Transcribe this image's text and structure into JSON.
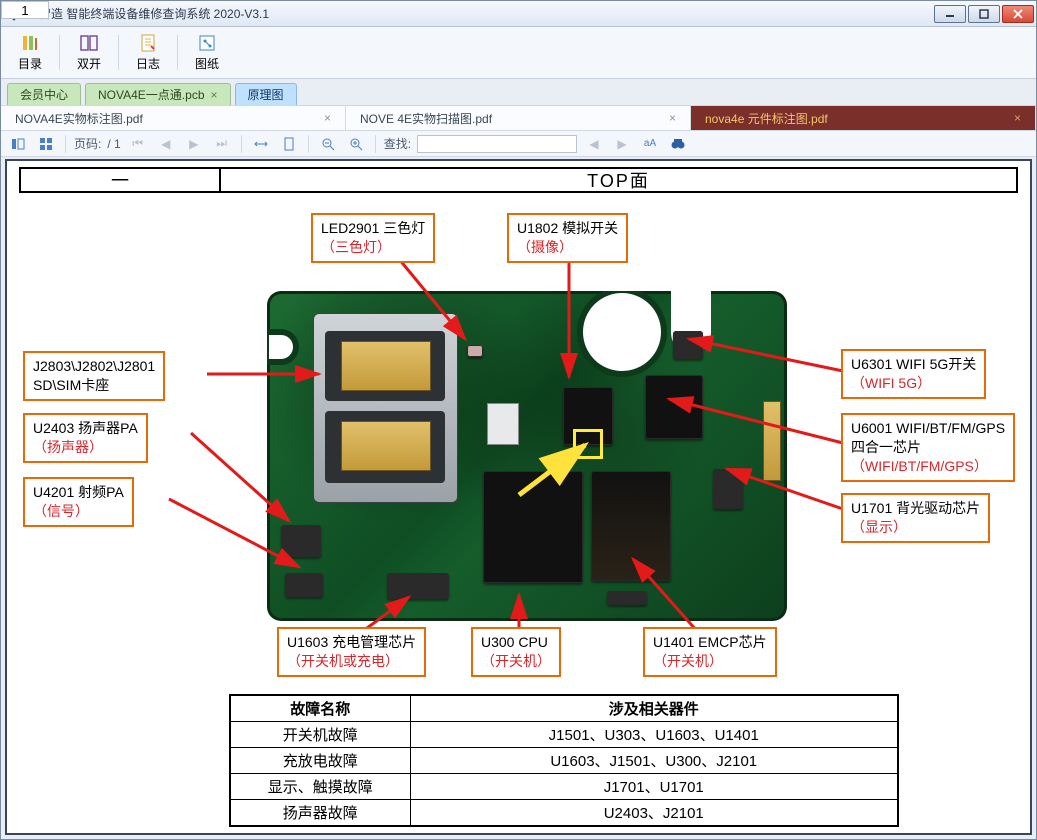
{
  "window": {
    "title": "鑫智造 智能终端设备维修查询系统 2020-V3.1"
  },
  "toolbar": {
    "catalog": "目录",
    "dual": "双开",
    "log": "日志",
    "drawing": "图纸"
  },
  "main_tabs": [
    {
      "label": "会员中心"
    },
    {
      "label": "NOVA4E一点通.pcb"
    },
    {
      "label": "原理图",
      "active": true
    }
  ],
  "sub_tabs": [
    {
      "label": "NOVA4E实物标注图.pdf"
    },
    {
      "label": "NOVE 4E实物扫描图.pdf"
    },
    {
      "label": "nova4e 元件标注图.pdf",
      "active": true
    }
  ],
  "pdf_bar": {
    "page_label": "页码:",
    "page_value": "1",
    "page_total": "/ 1",
    "find_label": "查找:"
  },
  "doc": {
    "head_a": "一",
    "head_b": "TOP面",
    "callouts": {
      "led2901": {
        "t1": "LED2901  三色灯",
        "t2": "（三色灯）"
      },
      "u1802": {
        "t1": "U1802 模拟开关",
        "t2": "（摄像）"
      },
      "j2803": {
        "t1": "J2803\\J2802\\J2801",
        "t2": "SD\\SIM卡座"
      },
      "u2403": {
        "t1": "U2403 扬声器PA",
        "t2": "（扬声器）"
      },
      "u4201": {
        "t1": "U4201  射频PA",
        "t2": "（信号）"
      },
      "u6301": {
        "t1": "U6301 WIFI 5G开关",
        "t2": "（WIFI 5G）"
      },
      "u6001": {
        "t1": "U6001 WIFI/BT/FM/GPS",
        "t2": "四合一芯片",
        "t3": "（WIFI/BT/FM/GPS）"
      },
      "u1701": {
        "t1": "U1701 背光驱动芯片",
        "t2": "（显示）"
      },
      "u1603": {
        "t1": "U1603 充电管理芯片",
        "t2": "（开关机或充电）"
      },
      "u300": {
        "t1": "U300 CPU",
        "t2": "（开关机）"
      },
      "u1401": {
        "t1": "U1401 EMCP芯片",
        "t2": "（开关机）"
      }
    },
    "fault_table": {
      "h1": "故障名称",
      "h2": "涉及相关器件",
      "rows": [
        {
          "a": "开关机故障",
          "b": "J1501、U303、U1603、U1401"
        },
        {
          "a": "充放电故障",
          "b": "U1603、J1501、U300、J2101"
        },
        {
          "a": "显示、触摸故障",
          "b": "J1701、U1701"
        },
        {
          "a": "扬声器故障",
          "b": "U2403、J2101"
        }
      ]
    }
  }
}
